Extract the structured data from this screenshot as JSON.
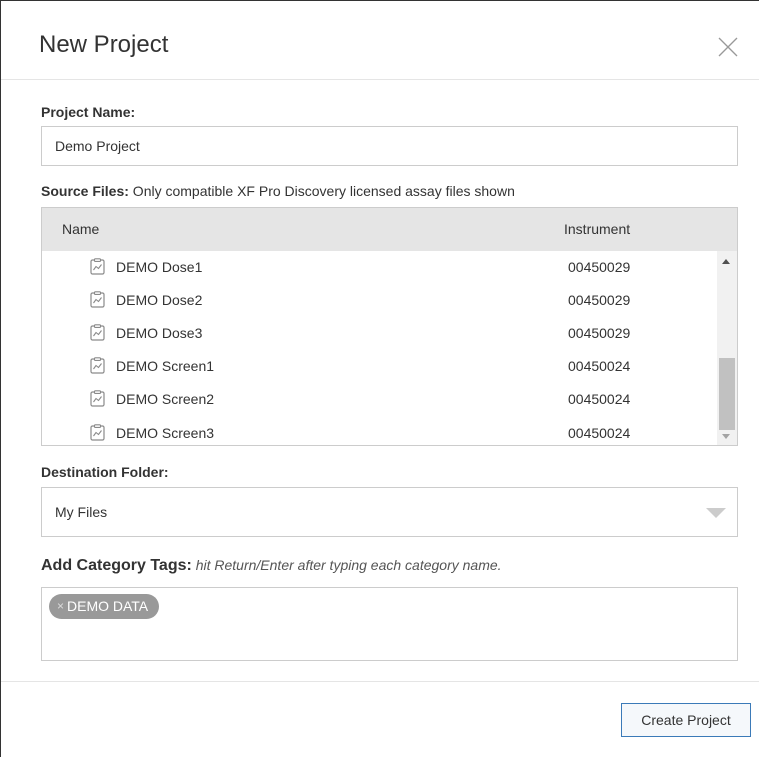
{
  "dialog": {
    "title": "New Project"
  },
  "project_name": {
    "label": "Project Name:",
    "value": "Demo Project"
  },
  "source_files": {
    "label": "Source Files:",
    "note": " Only compatible XF Pro Discovery licensed assay files shown",
    "columns": [
      "Name",
      "Instrument"
    ],
    "file_icon": "assay-file-icon",
    "rows": [
      {
        "name": "DEMO Dose1",
        "instrument": "00450029"
      },
      {
        "name": "DEMO Dose2",
        "instrument": "00450029"
      },
      {
        "name": "DEMO Dose3",
        "instrument": "00450029"
      },
      {
        "name": "DEMO Screen1",
        "instrument": "00450024"
      },
      {
        "name": "DEMO Screen2",
        "instrument": "00450024"
      },
      {
        "name": "DEMO Screen3",
        "instrument": "00450024"
      }
    ]
  },
  "destination": {
    "label": "Destination Folder:",
    "selected": "My Files"
  },
  "tags": {
    "label": "Add Category Tags:",
    "hint": " hit Return/Enter after typing each category name.",
    "items": [
      {
        "label": "DEMO DATA",
        "remove_glyph": "×"
      }
    ]
  },
  "footer": {
    "create_label": "Create Project"
  },
  "colors": {
    "accent_border": "#3b7ab8",
    "header_bg": "#e5e5e5",
    "tag_bg": "#999999"
  }
}
